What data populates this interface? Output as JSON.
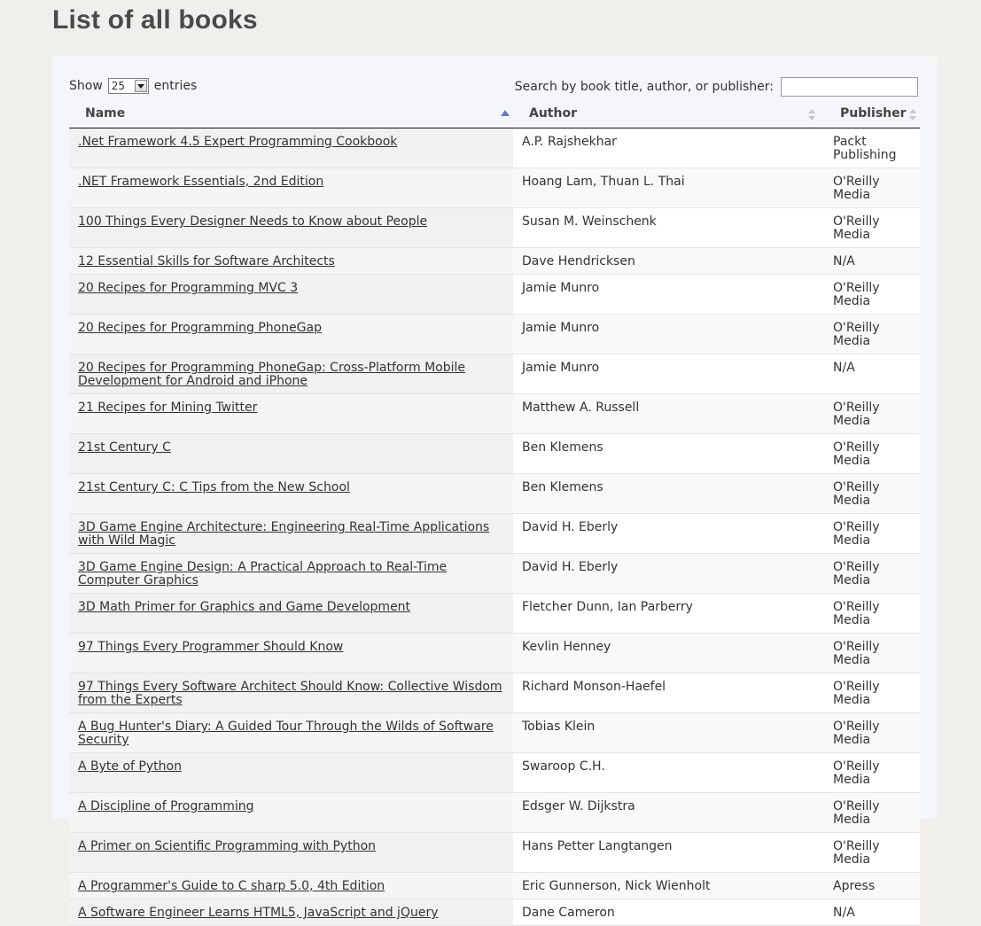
{
  "page": {
    "title": "List of all books"
  },
  "controls": {
    "show_label": "Show",
    "entries_value": "25",
    "entries_label": "entries",
    "search_label": "Search by book title, author, or publisher:",
    "search_value": ""
  },
  "table": {
    "headers": {
      "name": "Name",
      "author": "Author",
      "publisher": "Publisher"
    },
    "rows": [
      {
        "name": ".Net Framework 4.5 Expert Programming Cookbook",
        "author": "A.P. Rajshekhar",
        "publisher": "Packt Publishing"
      },
      {
        "name": ".NET Framework Essentials, 2nd Edition",
        "author": "Hoang Lam, Thuan L. Thai",
        "publisher": "O'Reilly Media"
      },
      {
        "name": "100 Things Every Designer Needs to Know about People",
        "author": "Susan M. Weinschenk",
        "publisher": "O'Reilly Media"
      },
      {
        "name": "12 Essential Skills for Software Architects",
        "author": "Dave Hendricksen",
        "publisher": "N/A"
      },
      {
        "name": "20 Recipes for Programming MVC 3",
        "author": "Jamie Munro",
        "publisher": "O'Reilly Media"
      },
      {
        "name": "20 Recipes for Programming PhoneGap",
        "author": "Jamie Munro",
        "publisher": "O'Reilly Media"
      },
      {
        "name": "20 Recipes for Programming PhoneGap: Cross-Platform Mobile Development for Android and iPhone",
        "author": "Jamie Munro",
        "publisher": "N/A"
      },
      {
        "name": "21 Recipes for Mining Twitter",
        "author": "Matthew A. Russell",
        "publisher": "O'Reilly Media"
      },
      {
        "name": "21st Century C",
        "author": "Ben Klemens",
        "publisher": "O'Reilly Media"
      },
      {
        "name": "21st Century C: C Tips from the New School",
        "author": "Ben Klemens",
        "publisher": "O'Reilly Media"
      },
      {
        "name": "3D Game Engine Architecture: Engineering Real-Time Applications with Wild Magic",
        "author": "David H. Eberly",
        "publisher": "O'Reilly Media"
      },
      {
        "name": "3D Game Engine Design: A Practical Approach to Real-Time Computer Graphics",
        "author": "David H. Eberly",
        "publisher": "O'Reilly Media"
      },
      {
        "name": "3D Math Primer for Graphics and Game Development",
        "author": "Fletcher Dunn, Ian Parberry",
        "publisher": "O'Reilly Media"
      },
      {
        "name": "97 Things Every Programmer Should Know",
        "author": "Kevlin Henney",
        "publisher": "O'Reilly Media"
      },
      {
        "name": "97 Things Every Software Architect Should Know: Collective Wisdom from the Experts",
        "author": "Richard Monson-Haefel",
        "publisher": "O'Reilly Media"
      },
      {
        "name": "A Bug Hunter's Diary: A Guided Tour Through the Wilds of Software Security",
        "author": "Tobias Klein",
        "publisher": "O'Reilly Media"
      },
      {
        "name": "A Byte of Python",
        "author": "Swaroop C.H.",
        "publisher": "O'Reilly Media"
      },
      {
        "name": "A Discipline of Programming",
        "author": "Edsger W. Dijkstra",
        "publisher": "O'Reilly Media"
      },
      {
        "name": "A Primer on Scientific Programming with Python",
        "author": "Hans Petter Langtangen",
        "publisher": "O'Reilly Media"
      },
      {
        "name": "A Programmer's Guide to C sharp 5.0, 4th Edition",
        "author": "Eric Gunnerson, Nick Wienholt",
        "publisher": "Apress"
      },
      {
        "name": "A Software Engineer Learns HTML5, JavaScript and jQuery",
        "author": "Dane Cameron",
        "publisher": "N/A"
      }
    ]
  },
  "colors": {
    "background": "#f0efeb",
    "panel": "#f4f6f9",
    "sort_active": "#6a78c8",
    "sort_inactive": "#c4c8d0"
  }
}
